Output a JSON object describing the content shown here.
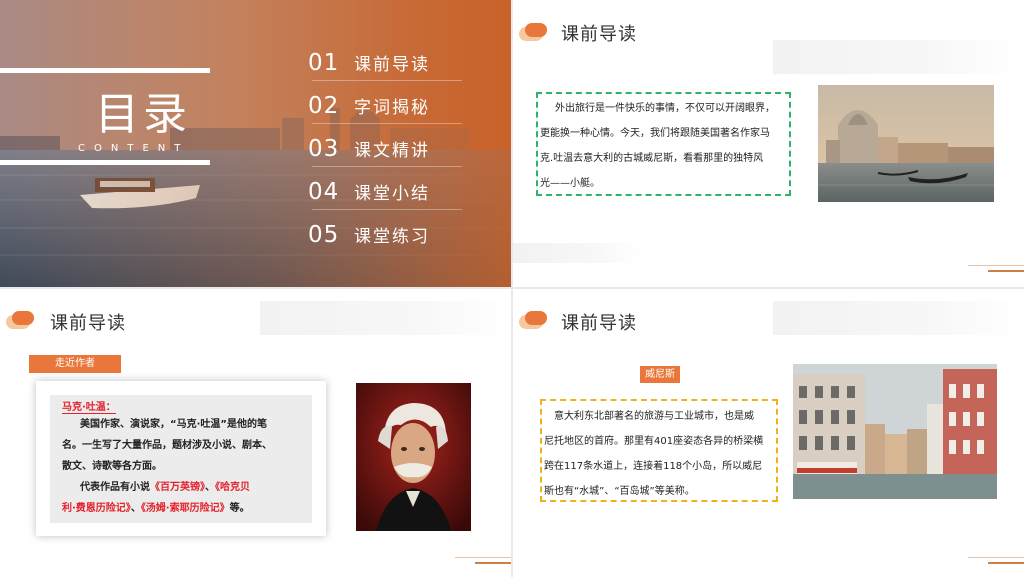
{
  "slide1": {
    "title": "目录",
    "subtitle": "CONTENT",
    "toc": [
      {
        "num": "01",
        "label": "课前导读"
      },
      {
        "num": "02",
        "label": "字词揭秘"
      },
      {
        "num": "03",
        "label": "课文精讲"
      },
      {
        "num": "04",
        "label": "课堂小结"
      },
      {
        "num": "05",
        "label": "课堂练习"
      }
    ]
  },
  "slide2": {
    "header": "课前导读",
    "lines": [
      "外出旅行是一件快乐的事情，不仅可以开阔眼界，",
      "更能换一种心情。今天，我们将跟随美国著名作家马",
      "克.吐温去意大利的古城威尼斯，看看那里的独特风",
      "光——小艇。"
    ]
  },
  "slide3": {
    "header": "课前导读",
    "tag": "走近作者",
    "name": "马克·吐温：",
    "line1": "美国作家、演说家，“马克·吐温”是他的笔",
    "line2": "名。一生写了大量作品，题材涉及小说、剧本、",
    "line3": "散文、诗歌等各方面。",
    "line4_pre": "代表作品有小说",
    "book1": "《百万英镑》",
    "sep1": "、",
    "book2_a": "《哈克贝",
    "book2_b": "利·费恩历险记》",
    "sep2": "、",
    "book3": "《汤姆·索耶历险记》",
    "line5_end": "等。"
  },
  "slide4": {
    "header": "课前导读",
    "tag": "威尼斯",
    "lines": [
      "意大利东北部著名的旅游与工业城市，也是威",
      "尼托地区的首府。那里有401座姿态各异的桥梁横",
      "跨在117条水道上，连接着118个小岛，所以威尼",
      "斯也有“水城”、“百岛城”等美称。"
    ]
  },
  "colors": {
    "accent": "#e9763a",
    "accent_light": "#f6c99c",
    "green_dash": "#2fb36b",
    "yellow_dash": "#f0b21a",
    "red_text": "#e4202a"
  }
}
